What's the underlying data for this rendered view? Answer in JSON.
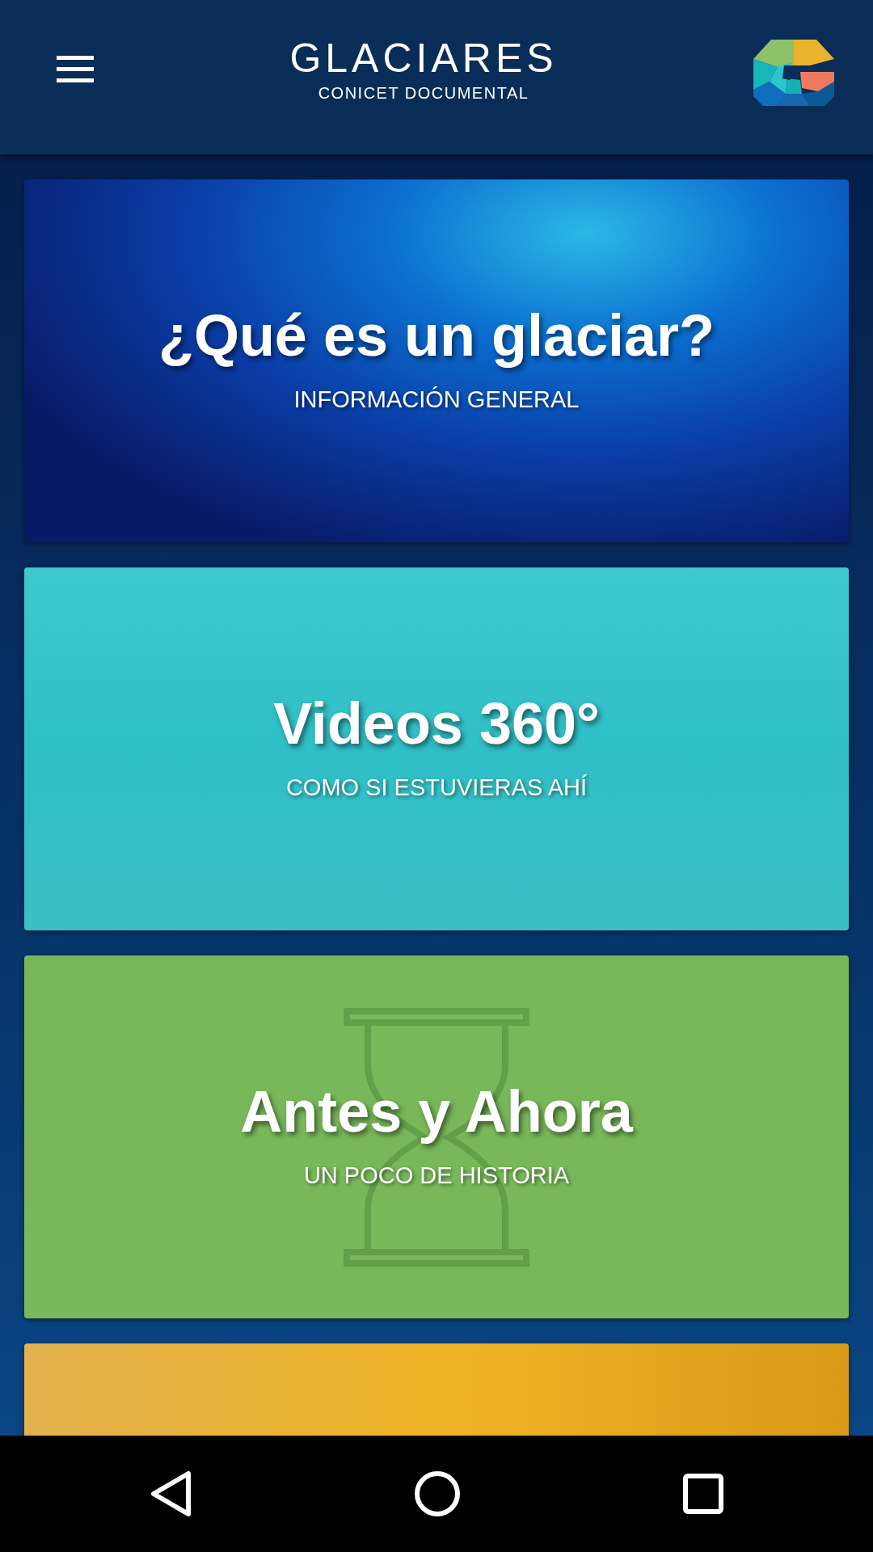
{
  "header": {
    "title": "GLACIARES",
    "subtitle": "CONICET DOCUMENTAL"
  },
  "cards": [
    {
      "kind": "space",
      "title": "¿Qué es un glaciar?",
      "subtitle": "INFORMACIÓN GENERAL"
    },
    {
      "kind": "glacier",
      "title": "Videos 360°",
      "subtitle": "COMO SI ESTUVIERAS AHÍ"
    },
    {
      "kind": "hourglass",
      "title": "Antes y Ahora",
      "subtitle": "UN POCO DE HISTORIA"
    },
    {
      "kind": "sunset"
    }
  ]
}
